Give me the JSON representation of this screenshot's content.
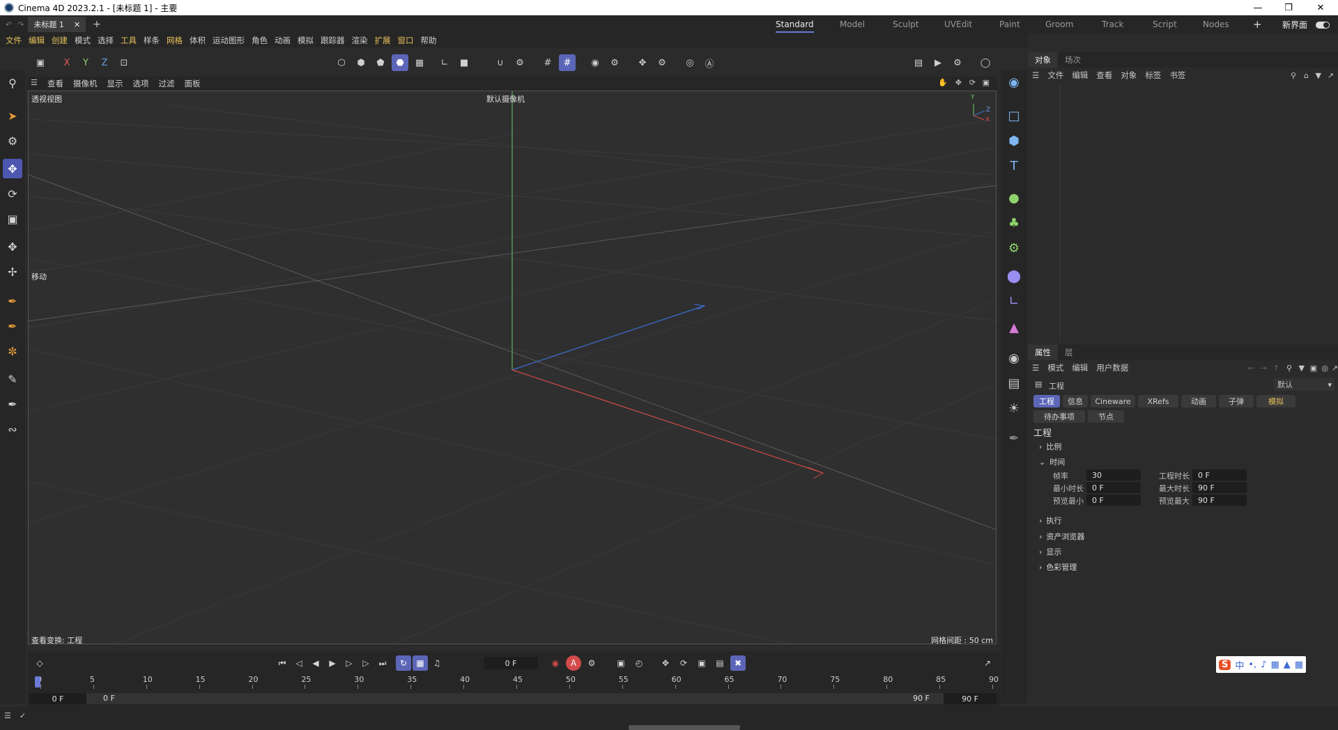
{
  "window": {
    "title": "Cinema 4D 2023.2.1 - [未标题 1] - 主要"
  },
  "doc_tabs": [
    {
      "label": "未标题 1"
    }
  ],
  "layouts": [
    "Standard",
    "Model",
    "Sculpt",
    "UVEdit",
    "Paint",
    "Groom",
    "Track",
    "Script",
    "Nodes"
  ],
  "active_layout": "Standard",
  "new_interface": "新界面",
  "menu": [
    "文件",
    "编辑",
    "创建",
    "模式",
    "选择",
    "工具",
    "样条",
    "网格",
    "体积",
    "运动图形",
    "角色",
    "动画",
    "模拟",
    "跟踪器",
    "渲染",
    "扩展",
    "窗口",
    "帮助"
  ],
  "axes": {
    "x": "X",
    "y": "Y",
    "z": "Z"
  },
  "viewport_menu": [
    "查看",
    "摄像机",
    "显示",
    "选项",
    "过滤",
    "面板"
  ],
  "viewport": {
    "view_name": "透视视图",
    "camera": "默认摄像机",
    "tool_label": "移动",
    "view_transform": "查看变换: 工程",
    "grid_spacing": "网格间距 : 50 cm",
    "axis_x": "X",
    "axis_y": "Y",
    "axis_z": "Z"
  },
  "object_panel": {
    "tabs": [
      "对象",
      "场次"
    ],
    "menu": [
      "文件",
      "编辑",
      "查看",
      "对象",
      "标签",
      "书签"
    ]
  },
  "attr_panel": {
    "tabs": [
      "属性",
      "层"
    ],
    "menu": [
      "模式",
      "编辑",
      "用户数据"
    ],
    "header": "工程",
    "preset": "默认",
    "chips_row1": [
      "工程",
      "信息",
      "Cineware",
      "XRefs",
      "动画",
      "子弹",
      "模拟"
    ],
    "chips_row2": [
      "待办事项",
      "节点"
    ],
    "section_title": "工程",
    "sections_top": [
      "比例",
      "时间"
    ],
    "time_fields": {
      "fps_label": "帧率",
      "fps": "30",
      "proj_len_label": "工程时长",
      "proj_len": "0 F",
      "min_label": "最小时长",
      "min": "0 F",
      "max_label": "最大时长",
      "max": "90 F",
      "pmin_label": "预览最小",
      "pmin": "0 F",
      "pmax_label": "预览最大",
      "pmax": "90 F"
    },
    "sections_bottom": [
      "执行",
      "资产浏览器",
      "显示",
      "色彩管理"
    ]
  },
  "timeline": {
    "current_frame": "0 F",
    "start": "0 F",
    "start2": "0 F",
    "end": "90 F",
    "end2": "90 F",
    "ticks": [
      0,
      5,
      10,
      15,
      20,
      25,
      30,
      35,
      40,
      45,
      50,
      55,
      60,
      65,
      70,
      75,
      80,
      85,
      90
    ],
    "record_label": "A"
  },
  "ime": {
    "brand": "S",
    "lang": "中"
  }
}
